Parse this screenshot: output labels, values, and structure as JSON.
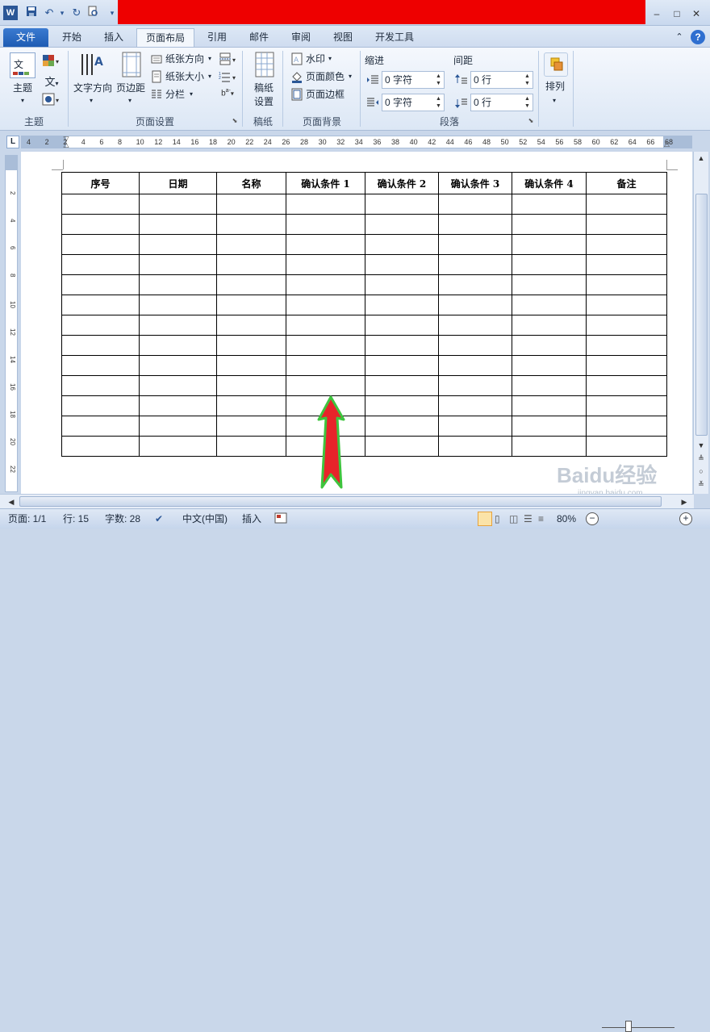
{
  "quick_access": {
    "word_logo": "W",
    "save_icon": "save-icon",
    "undo_icon": "undo-icon",
    "redo_icon": "redo-icon",
    "preview_icon": "print-preview-icon",
    "customize_icon": "customize-icon"
  },
  "window_controls": {
    "minimize": "–",
    "restore": "□",
    "close": "✕"
  },
  "tabs": [
    {
      "label": "文件"
    },
    {
      "label": "开始"
    },
    {
      "label": "插入"
    },
    {
      "label": "页面布局"
    },
    {
      "label": "引用"
    },
    {
      "label": "邮件"
    },
    {
      "label": "审阅"
    },
    {
      "label": "视图"
    },
    {
      "label": "开发工具"
    }
  ],
  "ribbon_right": {
    "collapse": "⌃",
    "help": "?"
  },
  "ribbon": {
    "themes": {
      "label": "主题",
      "group": "主题"
    },
    "page_setup": {
      "text_direction": "文字方向",
      "margins": "页边距",
      "orientation": "纸张方向",
      "size": "纸张大小",
      "columns": "分栏",
      "group": "页面设置"
    },
    "manuscript": {
      "label_line1": "稿纸",
      "label_line2": "设置",
      "group": "稿纸"
    },
    "page_background": {
      "watermark": "水印",
      "page_color": "页面颜色",
      "page_borders": "页面边框",
      "group": "页面背景"
    },
    "paragraph": {
      "indent_title": "缩进",
      "spacing_title": "间距",
      "indent_left": "0 字符",
      "indent_right": "0 字符",
      "spacing_before": "0 行",
      "spacing_after": "0 行",
      "group": "段落"
    },
    "arrange": {
      "label": "排列"
    }
  },
  "ruler": {
    "ticks": [
      "4",
      "2",
      "2",
      "4",
      "6",
      "8",
      "10",
      "12",
      "14",
      "16",
      "18",
      "20",
      "22",
      "24",
      "26",
      "28",
      "30",
      "32",
      "34",
      "36",
      "38",
      "40",
      "42",
      "44",
      "46",
      "48",
      "50",
      "52",
      "54",
      "56",
      "58",
      "60",
      "62",
      "64",
      "66",
      "68"
    ]
  },
  "vruler": {
    "ticks": [
      "2",
      "4",
      "6",
      "8",
      "10",
      "12",
      "14",
      "16",
      "18",
      "20",
      "22"
    ]
  },
  "table": {
    "headers": [
      "序号",
      "日期",
      "名称",
      "确认条件 1",
      "确认条件 2",
      "确认条件 3",
      "确认条件 4",
      "备注"
    ],
    "empty_rows": 13
  },
  "annotation": {
    "arrow_color": "#e8232a",
    "arrow_outline": "#3ec43e"
  },
  "watermark": {
    "text": "Baidu经验",
    "url": "jingyan.baidu.com"
  },
  "status": {
    "page": "页面: 1/1",
    "line": "行: 15",
    "words": "字数: 28",
    "language": "中文(中国)",
    "mode": "插入",
    "zoom": "80%"
  }
}
